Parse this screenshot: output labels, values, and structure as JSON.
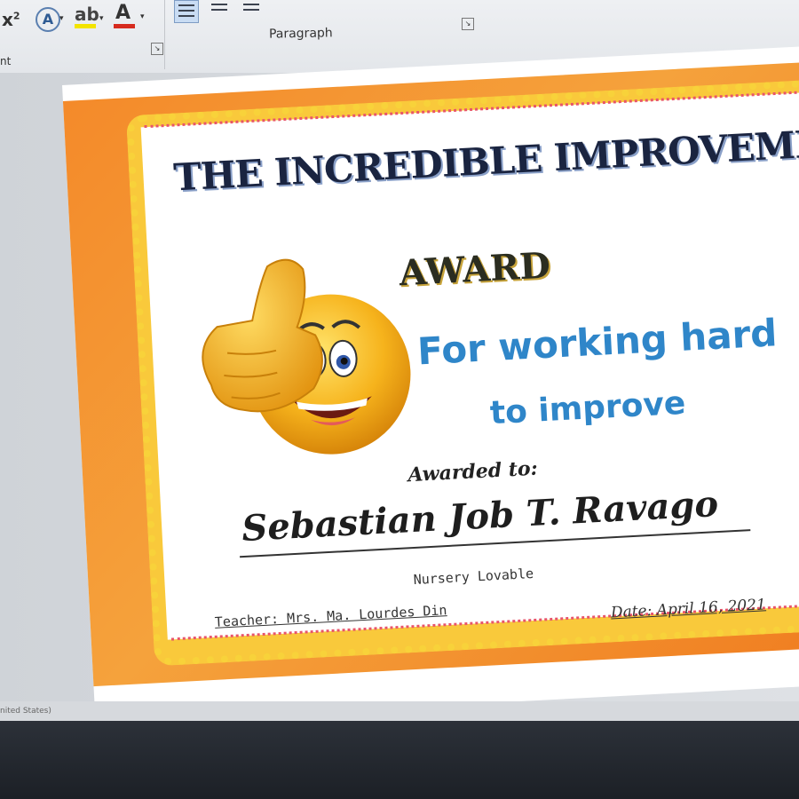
{
  "ribbon": {
    "superscript_label": "x",
    "superscript_mark": "2",
    "text_effects_glyph": "A",
    "highlight_glyph": "ab",
    "font_color_glyph": "A",
    "caret_glyph": "▾",
    "launcher_glyph": "↘",
    "paragraph_group_label": "Paragraph",
    "font_group_label": "nt",
    "highlight_color": "#f3e400",
    "font_color": "#d62b1f"
  },
  "status_bar": {
    "language": "nited States)"
  },
  "certificate": {
    "title": "THE INCREDIBLE IMPROVEMENT",
    "subtitle": "AWARD",
    "reason_line1": "For working hard",
    "reason_line2": "to improve",
    "awarded_to_label": "Awarded to:",
    "recipient_name": "Sebastian Job T. Ravago",
    "class_name": "Nursery Lovable",
    "teacher": "Teacher: Mrs. Ma. Lourdes Din",
    "date": "Date: April 16, 2021",
    "frame_color": "#f48a2a",
    "dotted_border_color": "#f9c93b",
    "reason_color": "#2f86c9",
    "emoji_icon": "thumbs-up-smiley-icon"
  }
}
